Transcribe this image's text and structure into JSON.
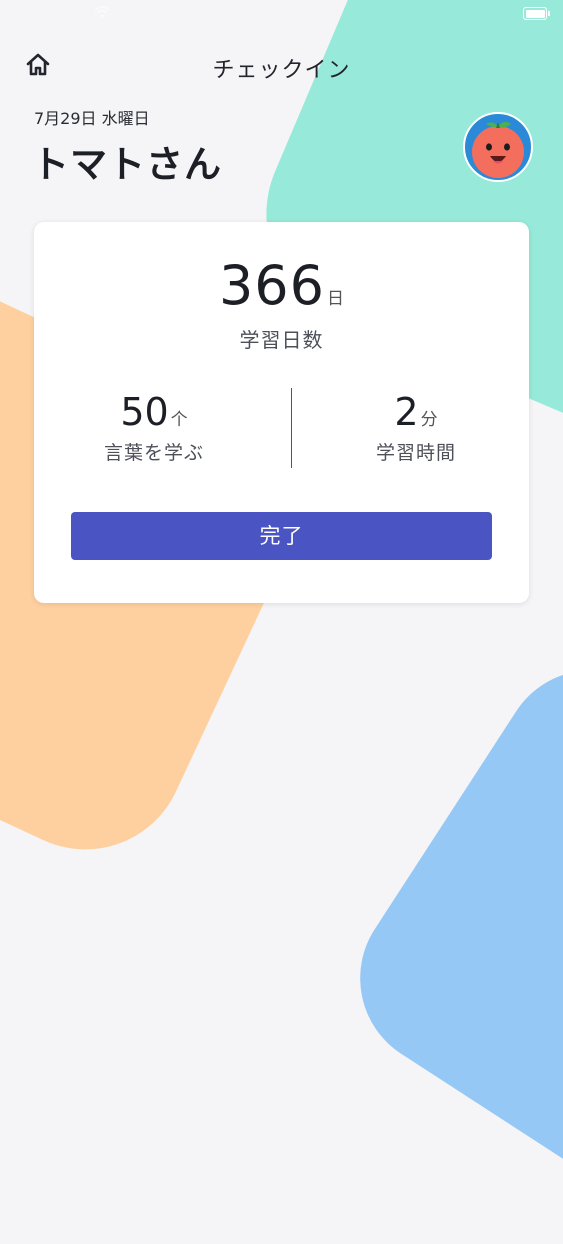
{
  "header": {
    "title": "チェックイン",
    "home_icon": "home-icon"
  },
  "profile": {
    "date": "7月29日 水曜日",
    "name": "トマトさん",
    "avatar_icon": "tomato-mascot-icon"
  },
  "card": {
    "total_days": {
      "value": "366",
      "unit": "日",
      "label": "学習日数"
    },
    "words": {
      "value": "50",
      "unit": "个",
      "label": "言葉を学ぶ"
    },
    "time": {
      "value": "2",
      "unit": "分",
      "label": "学習時間"
    },
    "complete_label": "完了"
  },
  "colors": {
    "accent": "#4b54c3",
    "teal_shape": "#97ead9",
    "orange_shape": "#fed0a0",
    "blue_shape": "#96c8f6",
    "background": "#f5f5f7"
  }
}
